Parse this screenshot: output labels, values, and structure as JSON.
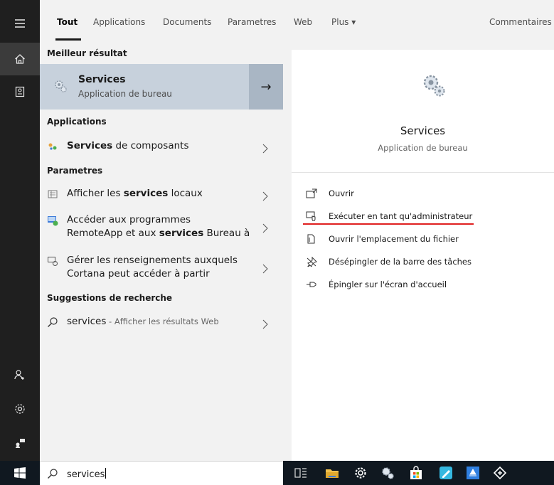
{
  "tabs": [
    {
      "label": "Tout",
      "selected": true
    },
    {
      "label": "Applications"
    },
    {
      "label": "Documents"
    },
    {
      "label": "Parametres"
    },
    {
      "label": "Web"
    },
    {
      "label": "Plus ▾"
    },
    {
      "label": "Commentaires"
    }
  ],
  "results": {
    "best_header": "Meilleur résultat",
    "best": {
      "title": "Services",
      "subtitle": "Application de bureau",
      "arrow": "→"
    },
    "apps_header": "Applications",
    "apps": [
      {
        "bold": "Services",
        "rest": " de composants"
      }
    ],
    "settings_header": "Parametres",
    "settings": [
      {
        "pre": "Afficher les ",
        "bold": "services",
        "post": " locaux"
      },
      {
        "line1": "Accéder aux programmes",
        "pre2": "RemoteApp et aux ",
        "bold": "services",
        "post2": " Bureau à"
      },
      {
        "line1": "Gérer les renseignements auxquels",
        "line2": "Cortana peut accéder à partir"
      }
    ],
    "suggest_header": "Suggestions de recherche",
    "suggest": {
      "term": "services",
      "suffix": " - Afficher les résultats Web"
    }
  },
  "preview": {
    "title": "Services",
    "subtitle": "Application de bureau",
    "actions": [
      {
        "label": "Ouvrir",
        "icon": "open-icon"
      },
      {
        "label": "Exécuter en tant qu'administrateur",
        "icon": "run-as-admin-icon"
      },
      {
        "label": "Ouvrir l'emplacement du fichier",
        "icon": "file-location-icon"
      },
      {
        "label": "Désépingler de la barre des tâches",
        "icon": "unpin-icon"
      },
      {
        "label": "Épingler sur l'écran d'accueil",
        "icon": "pin-icon"
      }
    ]
  },
  "search": {
    "value": "services"
  },
  "colors": {
    "selected_bg": "#c7d1dc",
    "arrow_bg": "#a9b6c4",
    "highlight_line": "#e02020",
    "rail": "#1f1f1f",
    "taskbar": "#101820"
  }
}
